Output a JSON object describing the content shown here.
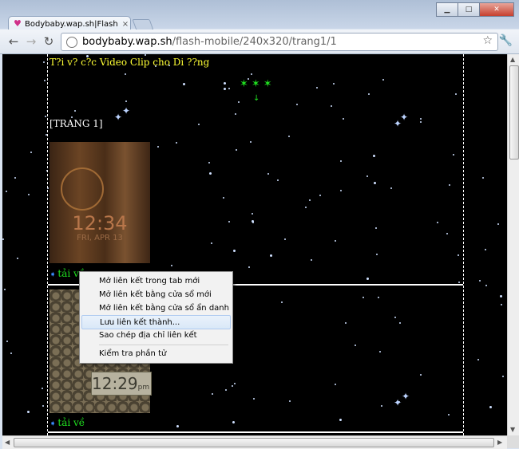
{
  "browser": {
    "tab_title": "Bodybaby.wap.sh|Flash Mà",
    "tab_close": "×",
    "url_host": "bodybaby.wap.sh",
    "url_path": "/flash-mobile/240x320/trang1/1"
  },
  "page": {
    "heading": "T?i v? c?c Video Clip cho Di ??ng",
    "green_stars": "✶✶✶",
    "page_label": "[TRANG 1]",
    "clock1_time": "12:34",
    "clock1_date": "FRI, APR 13",
    "clock2_time": "12:29",
    "clock2_ampm": "pm",
    "download_label_1": "tải về",
    "download_label_2": "tải về"
  },
  "context_menu": {
    "items": [
      "Mở liên kết trong tab mới",
      "Mở liên kết bằng cửa sổ mới",
      "Mở liên kết bằng cửa sổ ẩn danh",
      "Lưu liên kết thành...",
      "Sao chép địa chỉ liên kết",
      "Kiểm tra phần tử"
    ],
    "highlighted_index": 3
  },
  "colors": {
    "page_bg": "#000000",
    "heading": "#ffff33",
    "link_green": "#20e020"
  }
}
